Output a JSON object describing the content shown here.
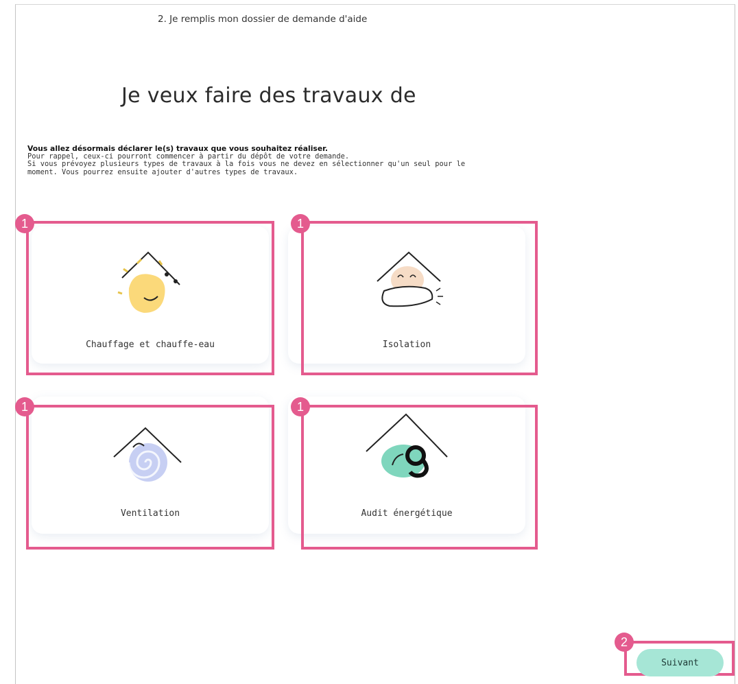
{
  "header": {
    "step": "2. Je remplis mon dossier de demande d'aide",
    "title": "Je veux faire des travaux de"
  },
  "intro": {
    "bold": "Vous allez désormais déclarer le(s) travaux que vous souhaitez réaliser.",
    "lines": [
      "Pour rappel, ceux-ci pourront commencer à partir du dépôt de votre demande.",
      "Si vous prévoyez plusieurs types de travaux à la fois vous ne devez en sélectionner qu'un seul pour le",
      "moment. Vous pourrez ensuite ajouter d'autres types de travaux."
    ]
  },
  "options": [
    {
      "label": "Chauffage et chauffe-eau",
      "icon": "sun-house-icon",
      "color": "#fbd97a"
    },
    {
      "label": "Isolation",
      "icon": "insulated-house-icon",
      "color": "#f6dcc6"
    },
    {
      "label": "Ventilation",
      "icon": "swirl-house-icon",
      "color": "#c7cff3"
    },
    {
      "label": "Audit énergétique",
      "icon": "audit-house-icon",
      "color": "#7fd6bd"
    }
  ],
  "annotations": {
    "badge_1": "1",
    "badge_2": "2"
  },
  "footer": {
    "next_label": "Suivant"
  },
  "colors": {
    "highlight": "#e45b8e",
    "next_button": "#a6e6d6"
  }
}
